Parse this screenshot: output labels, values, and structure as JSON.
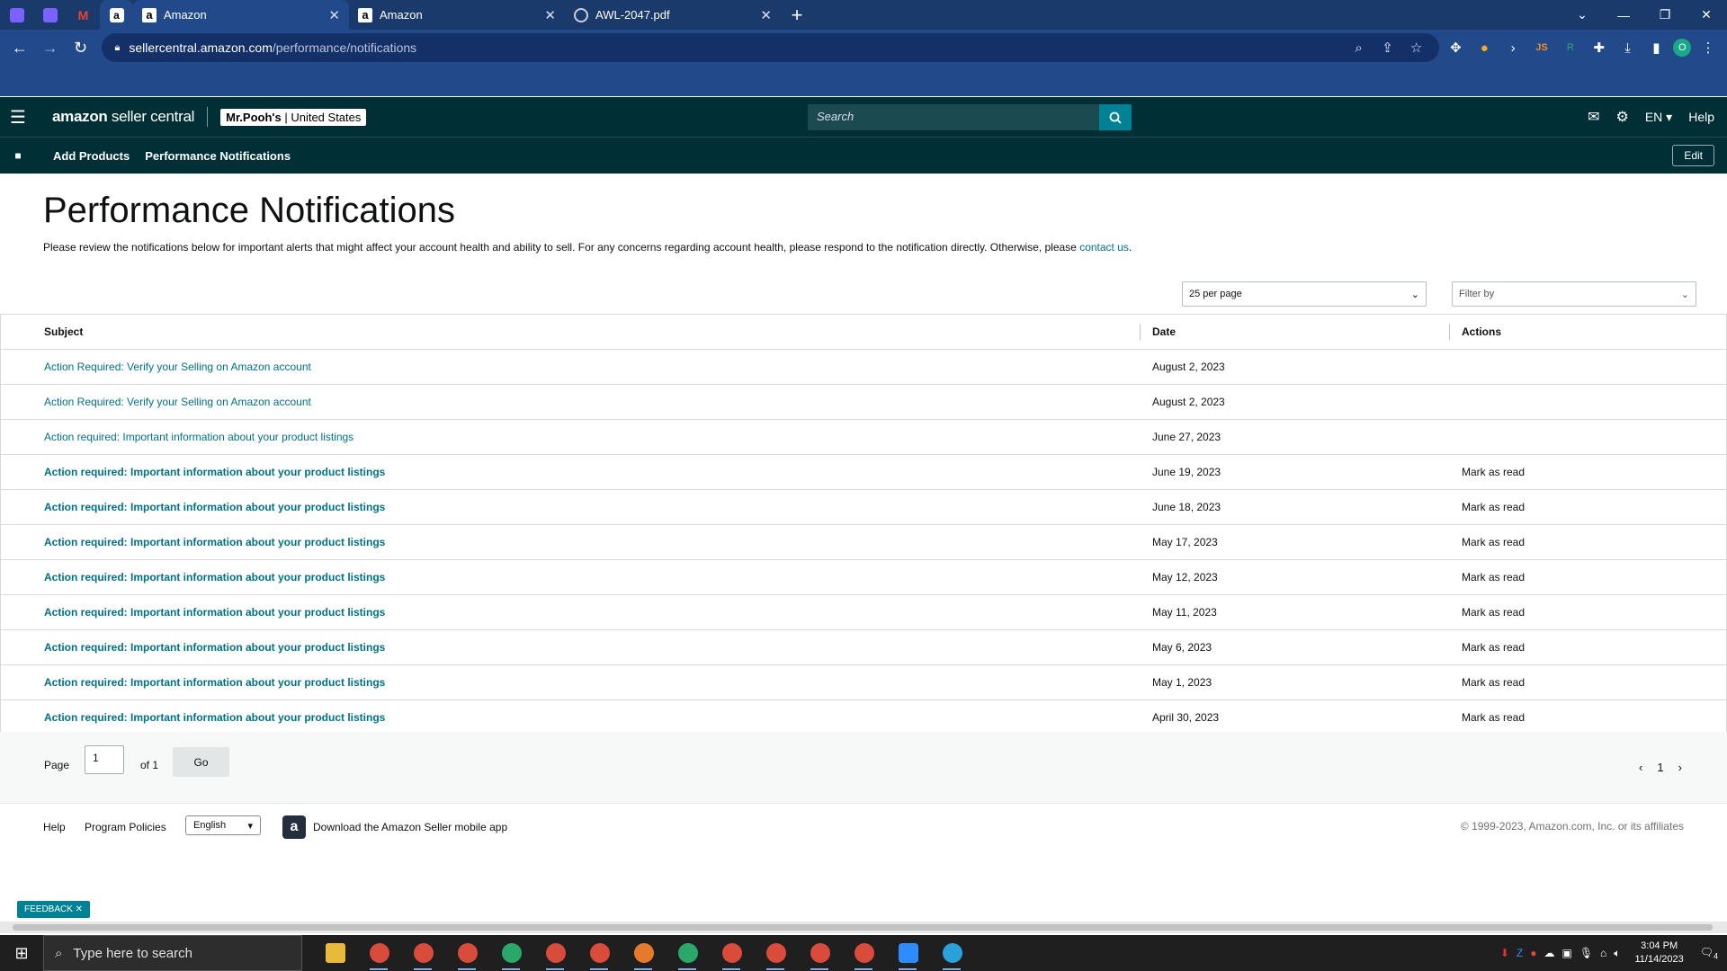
{
  "browser": {
    "tabs": [
      {
        "title": "Amazon",
        "favicon": "amazon-icon",
        "active": true
      },
      {
        "title": "Amazon",
        "favicon": "amazon-icon",
        "active": false
      },
      {
        "title": "AWL-2047.pdf",
        "favicon": "globe-icon",
        "active": false
      }
    ],
    "url_host": "sellercentral.amazon.com",
    "url_path": "/performance/notifications",
    "profile_initial": "O"
  },
  "header": {
    "logo_bold": "amazon",
    "logo_light": " seller central",
    "store_name": "Mr.Pooh's",
    "store_region": "United States",
    "search_placeholder": "Search",
    "language": "EN",
    "help": "Help"
  },
  "subnav": {
    "items": [
      "Add Products",
      "Performance Notifications"
    ],
    "edit": "Edit"
  },
  "main": {
    "title": "Performance Notifications",
    "intro_text": "Please review the notifications below for important alerts that might affect your account health and ability to sell. For any concerns regarding account health, please respond to the notification directly. Otherwise, please ",
    "intro_link": "contact us",
    "intro_end": ".",
    "per_page": "25 per page",
    "filter_placeholder": "Filter by",
    "columns": {
      "subject": "Subject",
      "date": "Date",
      "actions": "Actions"
    },
    "rows": [
      {
        "subject": "Action Required: Verify your Selling on Amazon account",
        "date": "August 2, 2023",
        "action": "",
        "unread": false
      },
      {
        "subject": "Action Required: Verify your Selling on Amazon account",
        "date": "August 2, 2023",
        "action": "",
        "unread": false
      },
      {
        "subject": "Action required: Important information about your product listings",
        "date": "June 27, 2023",
        "action": "",
        "unread": false
      },
      {
        "subject": "Action required: Important information about your product listings",
        "date": "June 19, 2023",
        "action": "Mark as read",
        "unread": true
      },
      {
        "subject": "Action required: Important information about your product listings",
        "date": "June 18, 2023",
        "action": "Mark as read",
        "unread": true
      },
      {
        "subject": "Action required: Important information about your product listings",
        "date": "May 17, 2023",
        "action": "Mark as read",
        "unread": true
      },
      {
        "subject": "Action required: Important information about your product listings",
        "date": "May 12, 2023",
        "action": "Mark as read",
        "unread": true
      },
      {
        "subject": "Action required: Important information about your product listings",
        "date": "May 11, 2023",
        "action": "Mark as read",
        "unread": true
      },
      {
        "subject": "Action required: Important information about your product listings",
        "date": "May 6, 2023",
        "action": "Mark as read",
        "unread": true
      },
      {
        "subject": "Action required: Important information about your product listings",
        "date": "May 1, 2023",
        "action": "Mark as read",
        "unread": true
      },
      {
        "subject": "Action required: Important information about your product listings",
        "date": "April 30, 2023",
        "action": "Mark as read",
        "unread": true
      }
    ]
  },
  "pager": {
    "page_label": "Page",
    "page_value": "1",
    "of_label": "of 1",
    "go": "Go",
    "current": "1"
  },
  "footer": {
    "help": "Help",
    "policies": "Program Policies",
    "language": "English",
    "app_text": "Download the Amazon Seller mobile app",
    "copyright": "© 1999-2023, Amazon.com, Inc. or its affiliates",
    "feedback": "FEEDBACK"
  },
  "taskbar": {
    "search_placeholder": "Type here to search",
    "time": "3:04 PM",
    "date": "11/14/2023",
    "notifications": "4"
  },
  "colors": {
    "header_bg": "#002f36",
    "link": "#007185",
    "browser_bg": "#22498a",
    "accent_teal": "#008296"
  }
}
